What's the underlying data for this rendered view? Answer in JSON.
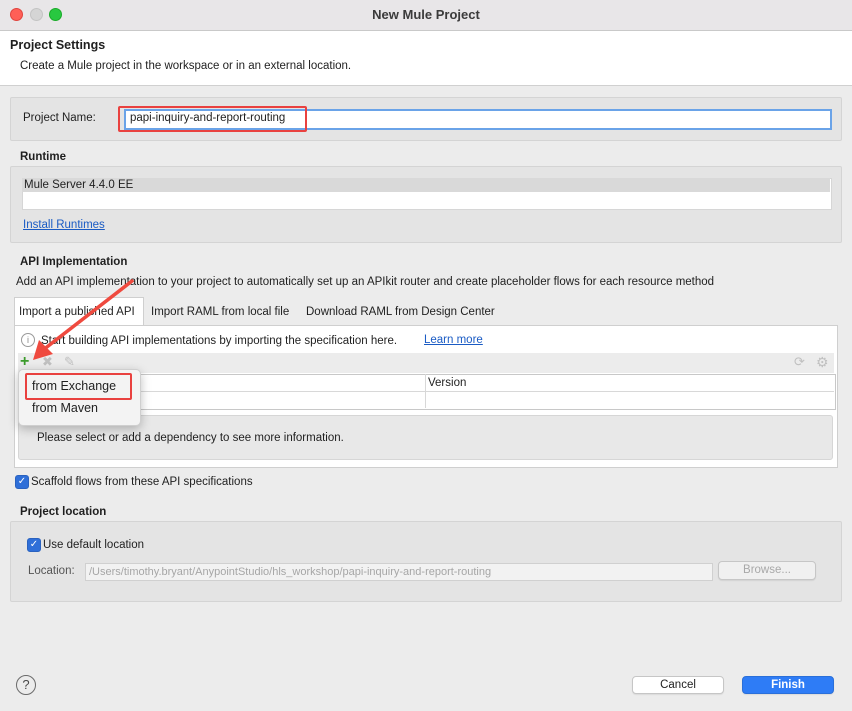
{
  "window": {
    "title": "New Mule Project"
  },
  "header": {
    "title": "Project Settings",
    "description": "Create a Mule project in the workspace or in an external location."
  },
  "project_name": {
    "label": "Project Name:",
    "value": "papi-inquiry-and-report-routing"
  },
  "runtime": {
    "section_title": "Runtime",
    "items": [
      "Mule Server 4.4.0 EE"
    ],
    "install_link": "Install Runtimes"
  },
  "api": {
    "section_title": "API Implementation",
    "description": "Add an API implementation to your project to automatically set up an APIkit router and create placeholder flows for each resource method",
    "tabs": [
      "Import a published API",
      "Import RAML from local file",
      "Download RAML from Design Center"
    ],
    "info_text": "Start building API implementations by importing the specification here.",
    "learn_more": "Learn more",
    "table_header_version": "Version",
    "detail_text": "Please select or add a dependency to see more information.",
    "menu": [
      "from Exchange",
      "from Maven"
    ],
    "scaffold_label": "Scaffold flows from these API specifications",
    "scaffold_checked": true
  },
  "location": {
    "section_title": "Project location",
    "use_default_label": "Use default location",
    "use_default_checked": true,
    "location_label": "Location:",
    "location_value": "/Users/timothy.bryant/AnypointStudio/hls_workshop/papi-inquiry-and-report-routing",
    "browse_label": "Browse..."
  },
  "footer": {
    "help": "?",
    "cancel": "Cancel",
    "finish": "Finish"
  },
  "colors": {
    "accent": "#2e7cf6",
    "highlight": "#e9413f",
    "link": "#1a5bc4"
  }
}
